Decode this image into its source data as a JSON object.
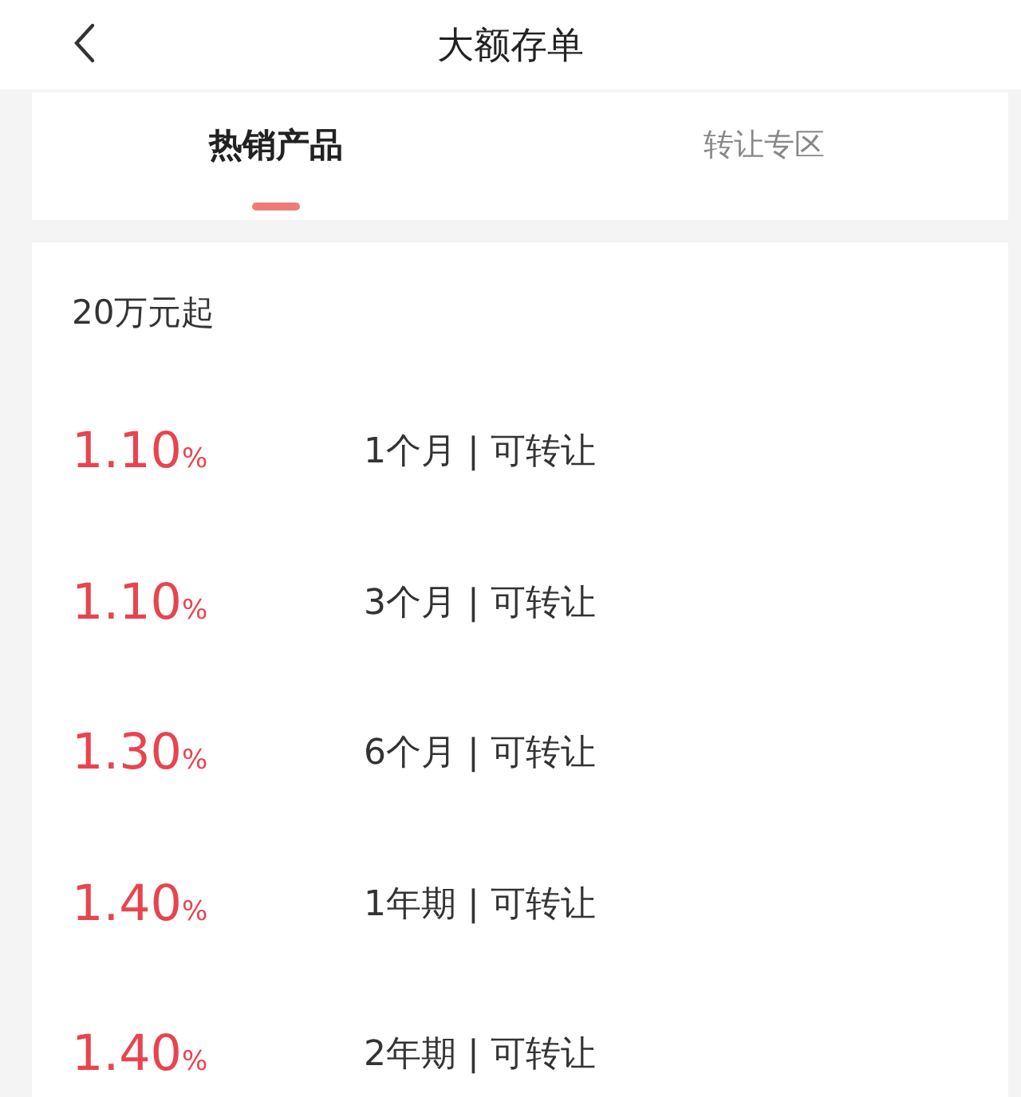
{
  "header": {
    "title": "大额存单"
  },
  "tabs": [
    {
      "label": "热销产品",
      "selected": true
    },
    {
      "label": "转让专区",
      "selected": false
    }
  ],
  "section": {
    "title": "20万元起"
  },
  "products": [
    {
      "rate": "1.10",
      "unit": "%",
      "term": "1个月 | 可转让"
    },
    {
      "rate": "1.10",
      "unit": "%",
      "term": "3个月 | 可转让"
    },
    {
      "rate": "1.30",
      "unit": "%",
      "term": "6个月 | 可转让"
    },
    {
      "rate": "1.40",
      "unit": "%",
      "term": "1年期 | 可转让"
    },
    {
      "rate": "1.40",
      "unit": "%",
      "term": "2年期 | 可转让"
    }
  ]
}
